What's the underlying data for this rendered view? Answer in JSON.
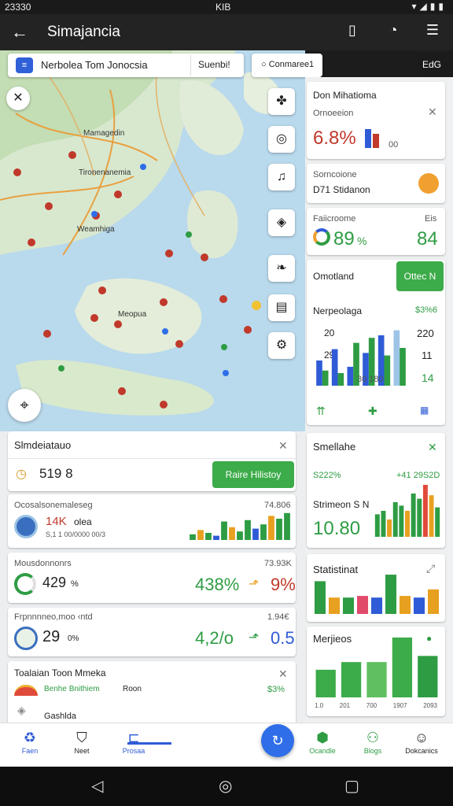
{
  "status_bar": {
    "time": "23330",
    "center": "KIB",
    "right": "▾◢▮▮"
  },
  "app_bar": {
    "title": "Simajancia",
    "back_icon": "arrow-left-icon",
    "icons": [
      "tablet-icon",
      "notification-icon",
      "list-icon"
    ]
  },
  "search": {
    "query": "Nerbolea Tom Jonocsia",
    "filter_label": "Suenbi!",
    "chip_label": "Conmaree1",
    "top_chip": "EdG"
  },
  "map": {
    "labels": [
      "Mamagedin",
      "Tironenanemia",
      "Weamhiga",
      "Meopua"
    ],
    "tools": [
      "plant-icon",
      "target-icon",
      "bell-icon",
      "shield-icon",
      "leaf-icon",
      "doc-icon",
      "gear-icon"
    ]
  },
  "right_cards": {
    "card1": {
      "title": "Don Mihatioma",
      "sub": "Ornoeeion",
      "value": "6.8%",
      "suffix": "00"
    },
    "card2": {
      "title": "Sorncoione",
      "value": "D71 Stidanon"
    },
    "card3": {
      "title": "Faiicroome",
      "badge": "Eis",
      "value_a": "89",
      "unit": "%",
      "value_b": "84"
    },
    "card4": {
      "title": "Omotland",
      "button": "Ottec N",
      "chart_title": "Nerpeolaga",
      "chart_pct": "$3%6",
      "left_ticks": [
        "20",
        "29"
      ],
      "right_ticks": [
        "220",
        "11",
        "14"
      ],
      "xlabel": "30 180",
      "icons": [
        "sprout-icon",
        "puzzle-icon",
        "grid-icon"
      ]
    },
    "card5": {
      "title": "Smellahe",
      "left": "S222%",
      "right": "+41 29S2D",
      "sub": "Strimeon S N",
      "value": "10.80"
    },
    "card6": {
      "title": "Statistinat"
    },
    "card7": {
      "title": "Merjieos",
      "x_labels": [
        "1.0",
        "201",
        "700",
        "1907",
        "2093"
      ]
    }
  },
  "panel": {
    "header": {
      "title": "Slmdeiatauo",
      "value": "519 8",
      "button": "Raire Hilistoy"
    },
    "rows": [
      {
        "title": "Ocosalsonemaleseg",
        "right": "74.806",
        "value": "14K",
        "value_suffix": "olea",
        "sub": "S,1 1 00/0000  00/3",
        "color": "#c0392b"
      },
      {
        "title": "Mousdonnonrs",
        "right": "73.93K",
        "value": "429",
        "value_suffix": "%",
        "mid": "438%",
        "end": "9%",
        "color": "#2e9c43"
      },
      {
        "title": "Frpnnnneo,moo ‹ntd",
        "right": "1.94€",
        "value": "29",
        "value_suffix": "0%",
        "mid": "4,2/o",
        "end": "0.5",
        "color": "#2e9c43"
      }
    ],
    "last": {
      "title": "Toalaian Toon Mmeka",
      "chips": "Benhe Bnithiem",
      "chip_b": "Roon",
      "right": "$3%",
      "label": "Gashlda"
    }
  },
  "bottom_nav": [
    "Faen",
    "Neet",
    "Prosaa",
    "Ocandle",
    "Blogs",
    "Dokcanics"
  ],
  "fab_icon": "refresh-icon",
  "chart_data": [
    {
      "type": "bar",
      "series": [
        {
          "values": [
            20,
            29,
            15,
            26,
            40,
            44
          ]
        },
        {
          "values": [
            12,
            10,
            34,
            38,
            24,
            30
          ]
        }
      ],
      "ylim": [
        0,
        50
      ]
    },
    {
      "type": "bar",
      "values": [
        8,
        14,
        10,
        6,
        26,
        18,
        12,
        28,
        16,
        22,
        34,
        30,
        38
      ],
      "ylim": [
        0,
        40
      ]
    },
    {
      "type": "bar",
      "values": [
        26,
        30,
        20,
        40,
        36,
        30,
        50,
        44,
        60,
        48,
        34
      ],
      "ylim": [
        0,
        60
      ]
    },
    {
      "type": "bar",
      "values": [
        40,
        20,
        20,
        22,
        20,
        48,
        22,
        20,
        30
      ],
      "ylim": [
        0,
        50
      ]
    },
    {
      "type": "bar",
      "values": [
        36,
        46,
        46,
        78,
        54
      ],
      "ylim": [
        0,
        80
      ]
    }
  ]
}
